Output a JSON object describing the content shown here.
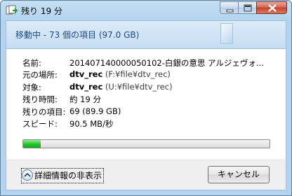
{
  "window": {
    "title": "残り 19 分",
    "controls": [
      "minimize-icon",
      "maximize-icon",
      "close-icon"
    ]
  },
  "header": {
    "text": "移動中 - 73 個の項目 (97.0 GB)"
  },
  "details": {
    "name_label": "名前:",
    "name_value": "201407140000050102-白銀の意思 アルジェヴォ...",
    "from_label": "元の場所:",
    "from_value": "dtv_rec",
    "from_path": " (F:¥file¥dtv_rec)",
    "to_label": "対象:",
    "to_value": "dtv_rec",
    "to_path": " (U:¥file¥dtv_rec)",
    "time_label": "残り時間:",
    "time_value": "約 19 分",
    "items_label": "残りの項目:",
    "items_value": "69 (89.9 GB)",
    "speed_label": "スピード:",
    "speed_value": "90.5 MB/秒"
  },
  "progress": {
    "fraction": 0.07,
    "color": "#25c22b"
  },
  "footer": {
    "toggle_label": "詳細情報の非表示",
    "cancel_label": "キャンセル"
  },
  "colors": {
    "header_text": "#1b4a8a",
    "frame": "#b3d3ee"
  }
}
